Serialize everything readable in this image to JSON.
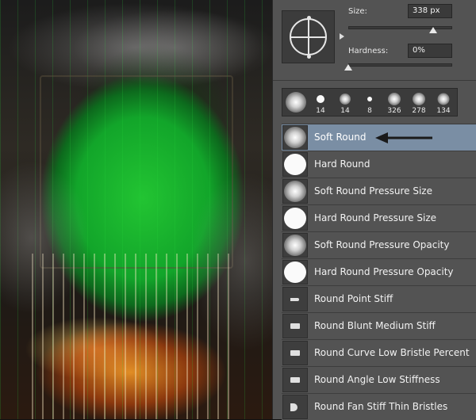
{
  "panel": {
    "size_label": "Size:",
    "size_value": "338 px",
    "size_fraction": 0.82,
    "hardness_label": "Hardness:",
    "hardness_value": "0%",
    "hardness_fraction": 0.0
  },
  "presets": [
    {
      "type": "soft",
      "size": ""
    },
    {
      "type": "hard",
      "size": "14"
    },
    {
      "type": "soft",
      "size": "14"
    },
    {
      "type": "hard",
      "size": "8"
    },
    {
      "type": "soft",
      "size": "326"
    },
    {
      "type": "soft",
      "size": "278"
    },
    {
      "type": "soft",
      "size": "134"
    }
  ],
  "brushes": [
    {
      "name": "Soft Round",
      "thumb": "soft",
      "selected": true
    },
    {
      "name": "Hard Round",
      "thumb": "hard"
    },
    {
      "name": "Soft Round Pressure Size",
      "thumb": "soft"
    },
    {
      "name": "Hard Round Pressure Size",
      "thumb": "hard"
    },
    {
      "name": "Soft Round Pressure Opacity",
      "thumb": "soft"
    },
    {
      "name": "Hard Round Pressure Opacity",
      "thumb": "hard"
    },
    {
      "name": "Round Point Stiff",
      "thumb": "point"
    },
    {
      "name": "Round Blunt Medium Stiff",
      "thumb": "blunt"
    },
    {
      "name": "Round Curve Low Bristle Percent",
      "thumb": "blunt"
    },
    {
      "name": "Round Angle Low Stiffness",
      "thumb": "blunt"
    },
    {
      "name": "Round Fan Stiff Thin Bristles",
      "thumb": "fan"
    }
  ],
  "colors": {
    "panel_bg": "#535353",
    "selection": "#7a8ea4",
    "canvas_green": "#22c432"
  },
  "icons": {
    "brush_preview": "brush-angle-roundness-icon",
    "annotation": "pointer-arrow-icon"
  }
}
